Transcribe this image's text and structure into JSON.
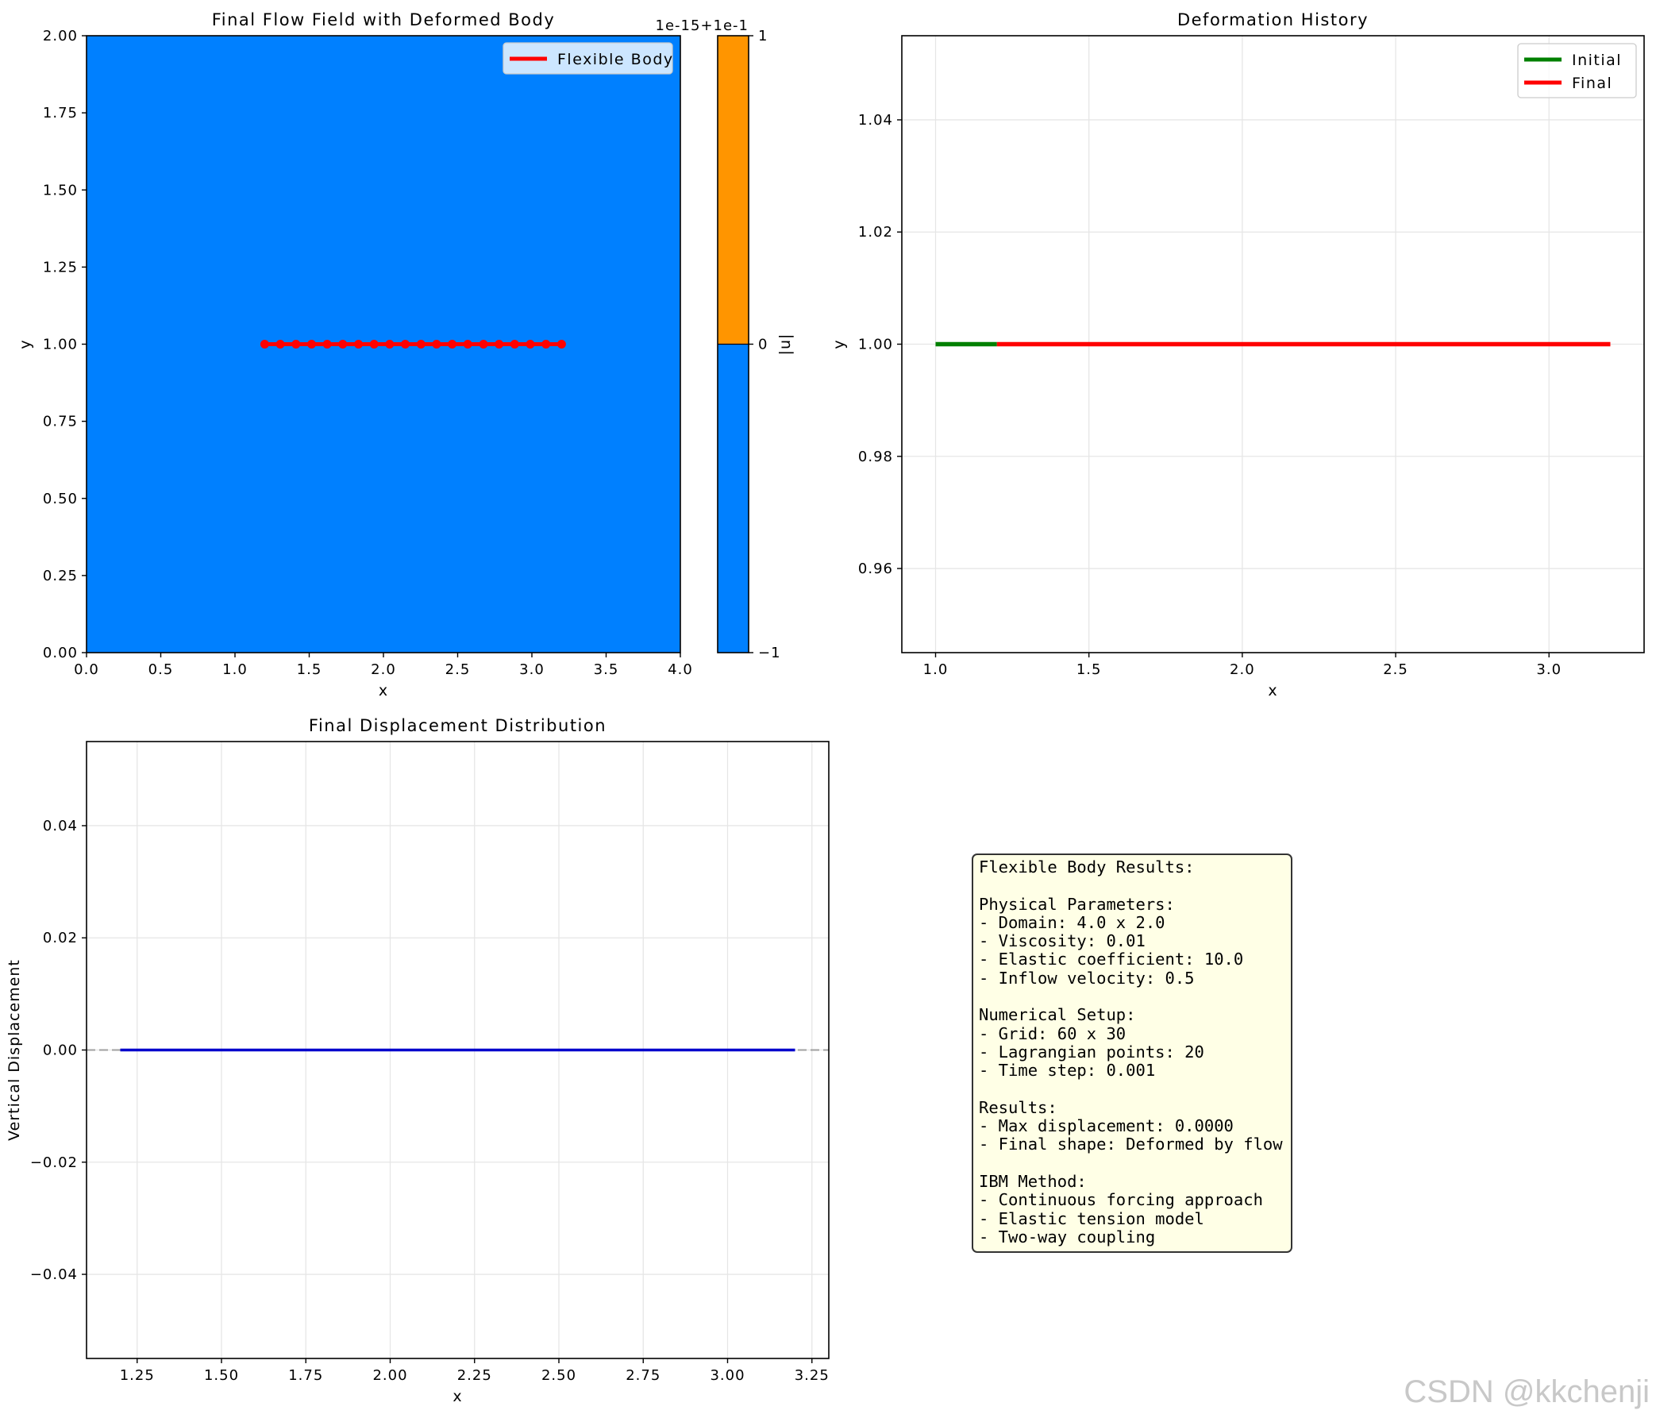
{
  "chart_data": [
    {
      "type": "heatmap",
      "title": "Final Flow Field with Deformed Body",
      "xlabel": "x",
      "ylabel": "y",
      "xlim": [
        0,
        4
      ],
      "ylim": [
        0,
        2
      ],
      "x_ticks": [
        "0.0",
        "0.5",
        "1.0",
        "1.5",
        "2.0",
        "2.5",
        "3.0",
        "3.5",
        "4.0"
      ],
      "y_ticks": [
        "0.00",
        "0.25",
        "0.50",
        "0.75",
        "1.00",
        "1.25",
        "1.50",
        "1.75",
        "2.00"
      ],
      "field_color": "#0080ff",
      "colorbar": {
        "label": "|u|",
        "offset_text": "1e-15+1e-1",
        "ticks": [
          "−1",
          "0",
          "1"
        ],
        "colors": [
          "#0080ff",
          "#ff9500"
        ]
      },
      "legend": [
        "Flexible Body"
      ],
      "legend_position": "upper right",
      "body": {
        "name": "Flexible Body",
        "color": "#ff0000",
        "x": [
          1.2,
          1.305,
          1.411,
          1.516,
          1.621,
          1.726,
          1.832,
          1.937,
          2.042,
          2.147,
          2.253,
          2.358,
          2.463,
          2.568,
          2.674,
          2.779,
          2.884,
          2.989,
          3.095,
          3.2
        ],
        "y": [
          1,
          1,
          1,
          1,
          1,
          1,
          1,
          1,
          1,
          1,
          1,
          1,
          1,
          1,
          1,
          1,
          1,
          1,
          1,
          1
        ]
      }
    },
    {
      "type": "line",
      "title": "Deformation History",
      "xlabel": "x",
      "ylabel": "y",
      "xlim": [
        0.89,
        3.31
      ],
      "ylim": [
        0.945,
        1.055
      ],
      "x_ticks": [
        "1.0",
        "1.5",
        "2.0",
        "2.5",
        "3.0"
      ],
      "y_ticks": [
        "0.96",
        "0.98",
        "1.00",
        "1.02",
        "1.04"
      ],
      "grid": true,
      "legend_position": "upper right",
      "series": [
        {
          "name": "Initial",
          "color": "#008000",
          "x": [
            1.0,
            1.2
          ],
          "y": [
            1.0,
            1.0
          ]
        },
        {
          "name": "Final",
          "color": "#ff0000",
          "x": [
            1.2,
            3.2
          ],
          "y": [
            1.0,
            1.0
          ]
        }
      ]
    },
    {
      "type": "line",
      "title": "Final Displacement Distribution",
      "xlabel": "x",
      "ylabel": "Vertical Displacement",
      "xlim": [
        1.1,
        3.3
      ],
      "ylim": [
        -0.055,
        0.055
      ],
      "x_ticks": [
        "1.25",
        "1.50",
        "1.75",
        "2.00",
        "2.25",
        "2.50",
        "2.75",
        "3.00",
        "3.25"
      ],
      "y_ticks": [
        "−0.04",
        "−0.02",
        "0.00",
        "0.02",
        "0.04"
      ],
      "grid": true,
      "reference_line": {
        "y": 0,
        "color": "#a0a0a0",
        "style": "dashed"
      },
      "series": [
        {
          "color": "#0000cc",
          "x": [
            1.2,
            3.2
          ],
          "y": [
            0,
            0
          ]
        }
      ]
    }
  ],
  "info_box": {
    "lines": [
      "Flexible Body Results:",
      "",
      "Physical Parameters:",
      "- Domain: 4.0 x 2.0",
      "- Viscosity: 0.01",
      "- Elastic coefficient: 10.0",
      "- Inflow velocity: 0.5",
      "",
      "Numerical Setup:",
      "- Grid: 60 x 30",
      "- Lagrangian points: 20",
      "- Time step: 0.001",
      "",
      "Results:",
      "- Max displacement: 0.0000",
      "- Final shape: Deformed by flow",
      "",
      "IBM Method:",
      "- Continuous forcing approach",
      "- Elastic tension model",
      "- Two-way coupling"
    ]
  },
  "watermark": "CSDN @kkchenji"
}
